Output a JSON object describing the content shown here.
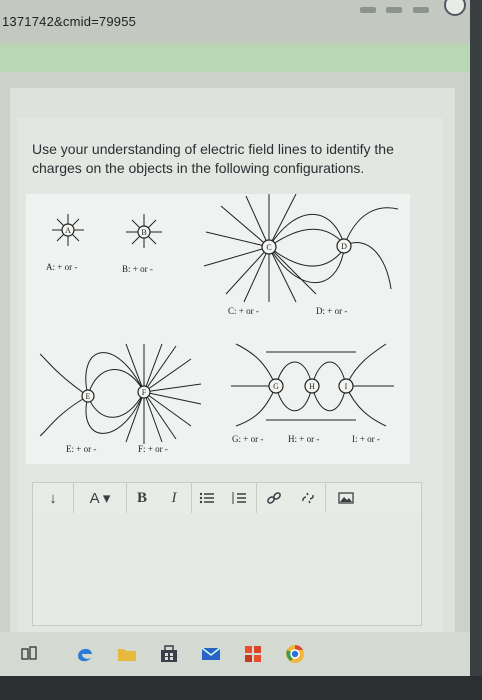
{
  "browser": {
    "url_fragment": "1371742&cmid=79955"
  },
  "question": {
    "text": "Use your understanding of electric field lines to identify the charges on the objects in the following configurations."
  },
  "figure": {
    "labels": {
      "A": "A: + or -",
      "B": "B: + or -",
      "C": "C: + or -",
      "D": "D: + or -",
      "E": "E: + or -",
      "F": "F: + or -",
      "G": "G: + or -",
      "H": "H: + or -",
      "I": "I: + or -"
    },
    "charge_letters": {
      "A": "A",
      "B": "B",
      "C": "C",
      "D": "D",
      "E": "E",
      "F": "F",
      "G": "G",
      "H": "H",
      "I": "I"
    }
  },
  "toolbar": {
    "paragraph_label": "↓",
    "font_label": "A ▾",
    "bold_label": "B",
    "italic_label": "I",
    "icons": [
      "paragraph-icon",
      "font-color-icon",
      "bold-icon",
      "italic-icon",
      "bullet-list-icon",
      "numbered-list-icon",
      "link-icon",
      "unlink-icon",
      "image-icon"
    ]
  },
  "taskbar": {
    "icons": [
      "task-view-icon",
      "edge-icon",
      "folder-icon",
      "store-icon",
      "mail-icon",
      "office-icon",
      "chrome-icon"
    ]
  }
}
